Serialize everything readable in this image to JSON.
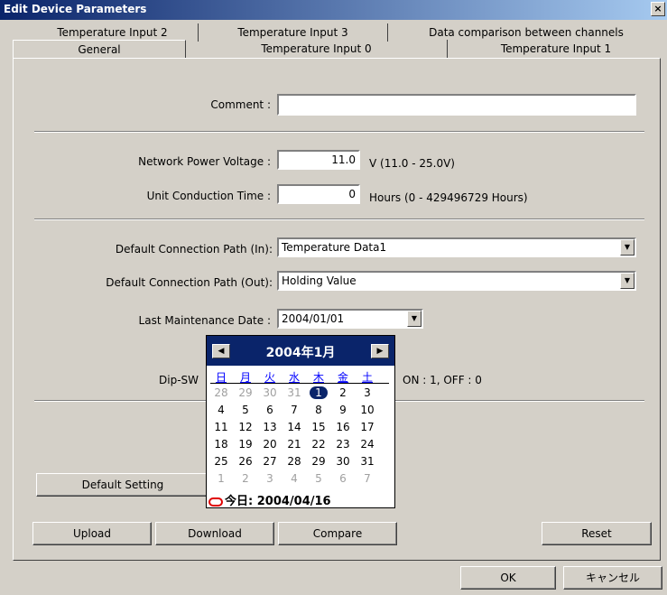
{
  "window": {
    "title": "Edit Device Parameters",
    "close": "×"
  },
  "tabs": {
    "back": [
      "Temperature Input 2",
      "Temperature Input 3",
      "Data comparison between channels"
    ],
    "front": [
      "General",
      "Temperature Input 0",
      "Temperature Input 1"
    ]
  },
  "form": {
    "comment_label": "Comment :",
    "comment_value": "",
    "npv_label": "Network Power Voltage :",
    "npv_value": "11.0",
    "npv_unit": "V (11.0 - 25.0V)",
    "uct_label": "Unit Conduction Time :",
    "uct_value": "0",
    "uct_unit": "Hours (0 - 429496729 Hours)",
    "path_in_label": "Default Connection Path (In):",
    "path_in_value": "Temperature Data1",
    "path_out_label": "Default Connection Path (Out):",
    "path_out_value": "Holding Value",
    "lmd_label": "Last Maintenance Date :",
    "lmd_value": "2004/01/01",
    "dip_label": "Dip-SW",
    "dip_hint": "ON : 1, OFF : 0"
  },
  "calendar": {
    "title": "2004年1月",
    "prev": "◀",
    "next": "▶",
    "weekdays": [
      "日",
      "月",
      "火",
      "水",
      "木",
      "金",
      "土"
    ],
    "rows": [
      [
        "28",
        "29",
        "30",
        "31",
        "1",
        "2",
        "3"
      ],
      [
        "4",
        "5",
        "6",
        "7",
        "8",
        "9",
        "10"
      ],
      [
        "11",
        "12",
        "13",
        "14",
        "15",
        "16",
        "17"
      ],
      [
        "18",
        "19",
        "20",
        "21",
        "22",
        "23",
        "24"
      ],
      [
        "25",
        "26",
        "27",
        "28",
        "29",
        "30",
        "31"
      ],
      [
        "1",
        "2",
        "3",
        "4",
        "5",
        "6",
        "7"
      ]
    ],
    "today": "今日: 2004/04/16"
  },
  "buttons": {
    "default_setting": "Default Setting",
    "upload": "Upload",
    "download": "Download",
    "compare": "Compare",
    "reset": "Reset",
    "ok": "OK",
    "cancel": "キャンセル"
  }
}
